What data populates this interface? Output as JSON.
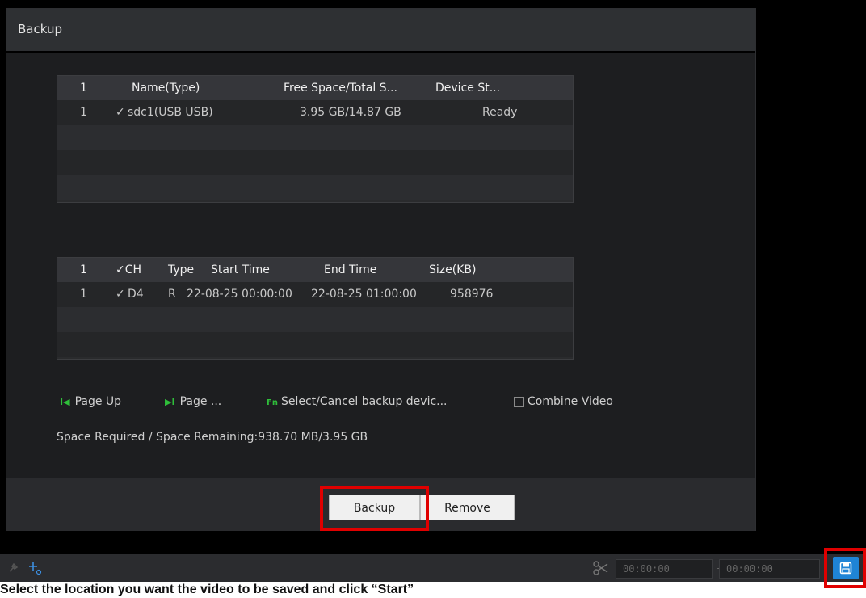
{
  "dialog": {
    "title": "Backup"
  },
  "device_table": {
    "headers": [
      "1",
      "Name(Type)",
      "Free Space/Total S...",
      "Device St..."
    ],
    "rows": [
      {
        "index": "1",
        "check": "✓",
        "name": "sdc1(USB USB)",
        "space": "3.95 GB/14.87 GB",
        "status": "Ready"
      }
    ]
  },
  "file_table": {
    "headers": [
      "1",
      "✓CH",
      "Type",
      "Start Time",
      "End Time",
      "Size(KB)"
    ],
    "rows": [
      {
        "index": "1",
        "check": "✓",
        "ch": "D4",
        "type": "R",
        "start": "22-08-25 00:00:00",
        "end": "22-08-25 01:00:00",
        "size": "958976"
      }
    ]
  },
  "controls": {
    "page_up_key": "I◀",
    "page_up": "Page Up",
    "page_down_key": "▶I",
    "page_down": "Page ...",
    "fn_key": "Fn",
    "select_cancel": "Select/Cancel backup devic...",
    "combine_video": "Combine Video",
    "combine_checked": false
  },
  "space_info": "Space Required / Space Remaining:938.70 MB/3.95 GB",
  "buttons": {
    "backup": "Backup",
    "remove": "Remove"
  },
  "playback_bar": {
    "time_start": "00:00:00",
    "separator": "-",
    "time_end": "00:00:00"
  },
  "caption": "Select the location you want the video to be saved and click “Start”",
  "colors": {
    "highlight": "#e00000",
    "accent_blue": "#1f84d6",
    "key_green": "#2fbf3a"
  }
}
